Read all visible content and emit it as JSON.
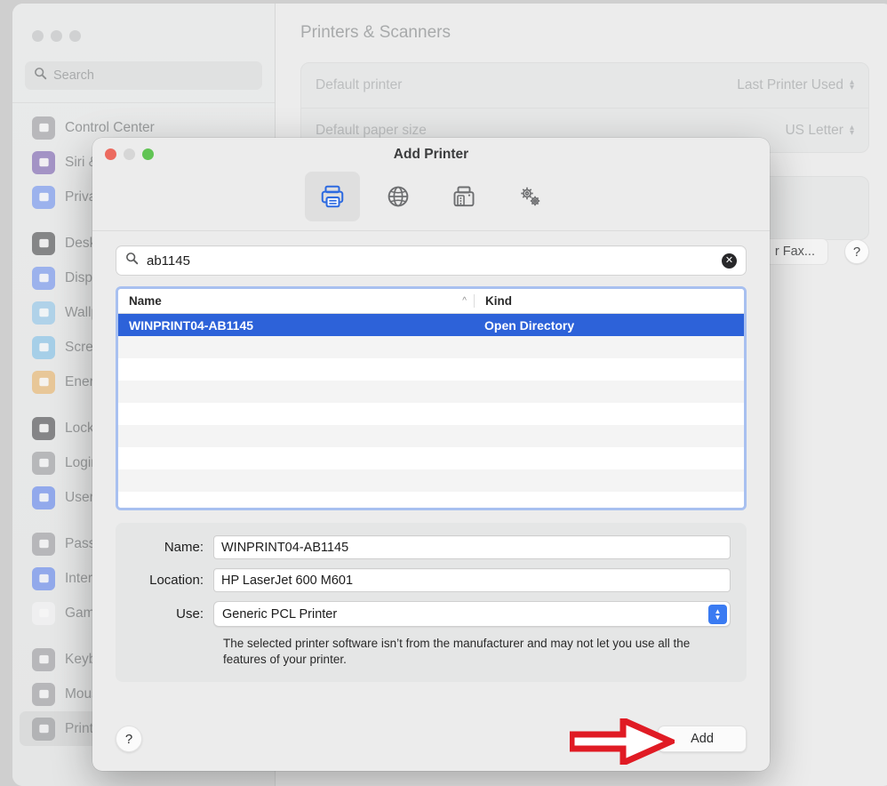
{
  "settings_window": {
    "title": "Printers & Scanners",
    "search": {
      "placeholder": "Search",
      "icon": "search-icon"
    },
    "sidebar_items": [
      {
        "label": "Control Center",
        "icon": "control-center-icon",
        "color": "#9b9b9f",
        "group": 0
      },
      {
        "label": "Siri &",
        "icon": "siri-icon",
        "color": "#7a5fb0",
        "group": 0
      },
      {
        "label": "Priva",
        "icon": "privacy-hand-icon",
        "color": "#6f91f0",
        "group": 0
      },
      {
        "label": "Desk",
        "icon": "desktop-dock-icon",
        "color": "#4a4a4c",
        "group": 1
      },
      {
        "label": "Displ",
        "icon": "display-brightness-icon",
        "color": "#6f91f0",
        "group": 1
      },
      {
        "label": "Wallp",
        "icon": "wallpaper-flower-icon",
        "color": "#8fc6ea",
        "group": 1
      },
      {
        "label": "Scree",
        "icon": "screensaver-moon-icon",
        "color": "#7fc0e8",
        "group": 1
      },
      {
        "label": "Energ",
        "icon": "energy-bulb-icon",
        "color": "#eab368",
        "group": 1
      },
      {
        "label": "Lock",
        "icon": "lock-screen-icon",
        "color": "#4a4a4c",
        "group": 2
      },
      {
        "label": "Login",
        "icon": "login-password-icon",
        "color": "#9b9b9f",
        "group": 2
      },
      {
        "label": "Users",
        "icon": "users-groups-icon",
        "color": "#5f84ef",
        "group": 2
      },
      {
        "label": "Passw",
        "icon": "passwords-key-icon",
        "color": "#9b9b9f",
        "group": 3
      },
      {
        "label": "Intern",
        "icon": "internet-accounts-at-icon",
        "color": "#5f84ef",
        "group": 3
      },
      {
        "label": "Game",
        "icon": "game-center-icon",
        "color": "#f5f5f7",
        "group": 3
      },
      {
        "label": "Keyb",
        "icon": "keyboard-icon",
        "color": "#9b9b9f",
        "group": 4
      },
      {
        "label": "Mous",
        "icon": "mouse-icon",
        "color": "#9b9b9f",
        "group": 4
      },
      {
        "label": "Printe",
        "icon": "printer-icon",
        "color": "#9b9b9f",
        "group": 4,
        "selected": true
      }
    ],
    "rows": [
      {
        "label": "Default printer",
        "value": "Last Printer Used"
      },
      {
        "label": "Default paper size",
        "value": "US Letter"
      }
    ],
    "add_button_label": "r Fax...",
    "help_label": "?"
  },
  "dialog": {
    "title": "Add Printer",
    "traffic_lights": {
      "close": "close-window-button",
      "minimize": "minimize-window-button",
      "maximize": "maximize-window-button"
    },
    "toolbar": [
      {
        "name": "default-browser-tab",
        "icon": "printer-icon",
        "active": true
      },
      {
        "name": "ip-tab",
        "icon": "globe-icon",
        "active": false
      },
      {
        "name": "windows-tab",
        "icon": "fax-printer-icon",
        "active": false
      },
      {
        "name": "advanced-tab",
        "icon": "gears-icon",
        "active": false
      }
    ],
    "search": {
      "value": "ab1145",
      "placeholder": "Search",
      "icon": "search-icon",
      "clear_icon": "clear-circle-icon"
    },
    "printer_table": {
      "columns": [
        "Name",
        "Kind",
        ""
      ],
      "sort_column": "Name",
      "sort_indicator": "ascending-chevron",
      "rows": [
        {
          "name": "WINPRINT04-AB1145",
          "kind": "Open Directory",
          "selected": true
        }
      ],
      "empty_row_count": 9
    },
    "form": {
      "name_label": "Name:",
      "name_value": "WINPRINT04-AB1145",
      "location_label": "Location:",
      "location_value": "HP LaserJet 600 M601",
      "use_label": "Use:",
      "use_value": "Generic PCL Printer",
      "note": "The selected printer software isn’t from the manufacturer and may not let you use all the features of your printer."
    },
    "footer": {
      "help_label": "?",
      "add_label": "Add"
    },
    "annotation": {
      "type": "red-arrow",
      "color": "#e01b24",
      "points_to": "Add"
    }
  }
}
